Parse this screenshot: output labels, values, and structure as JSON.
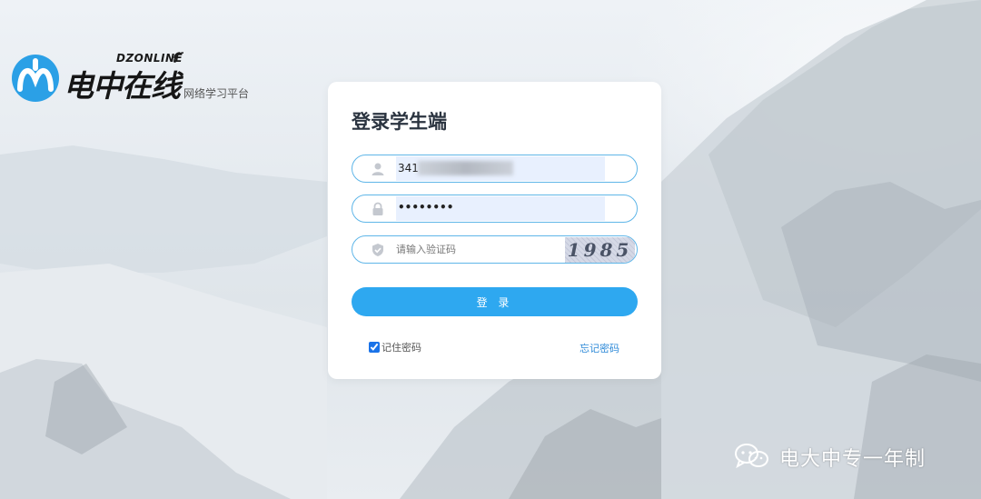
{
  "logo": {
    "brand_en": "DZONLINE",
    "brand_cn": "电中在线",
    "subtitle": "网络学习平台"
  },
  "login": {
    "title": "登录学生端",
    "username_value": "341",
    "password_value": "••••••••",
    "captcha_placeholder": "请输入验证码",
    "captcha_code": "1985",
    "submit_label": "登 录",
    "remember_label": "记住密码",
    "remember_checked": true,
    "forgot_label": "忘记密码"
  },
  "watermark": {
    "text": "电大中专一年制"
  },
  "colors": {
    "accent": "#2ea8f0",
    "field_border": "#5fb6e8",
    "link": "#2e8ad8",
    "autofill": "#e8f0fe"
  },
  "icons": {
    "username": "user-icon",
    "password": "lock-icon",
    "captcha": "shield-icon",
    "watermark": "wechat-icon"
  }
}
